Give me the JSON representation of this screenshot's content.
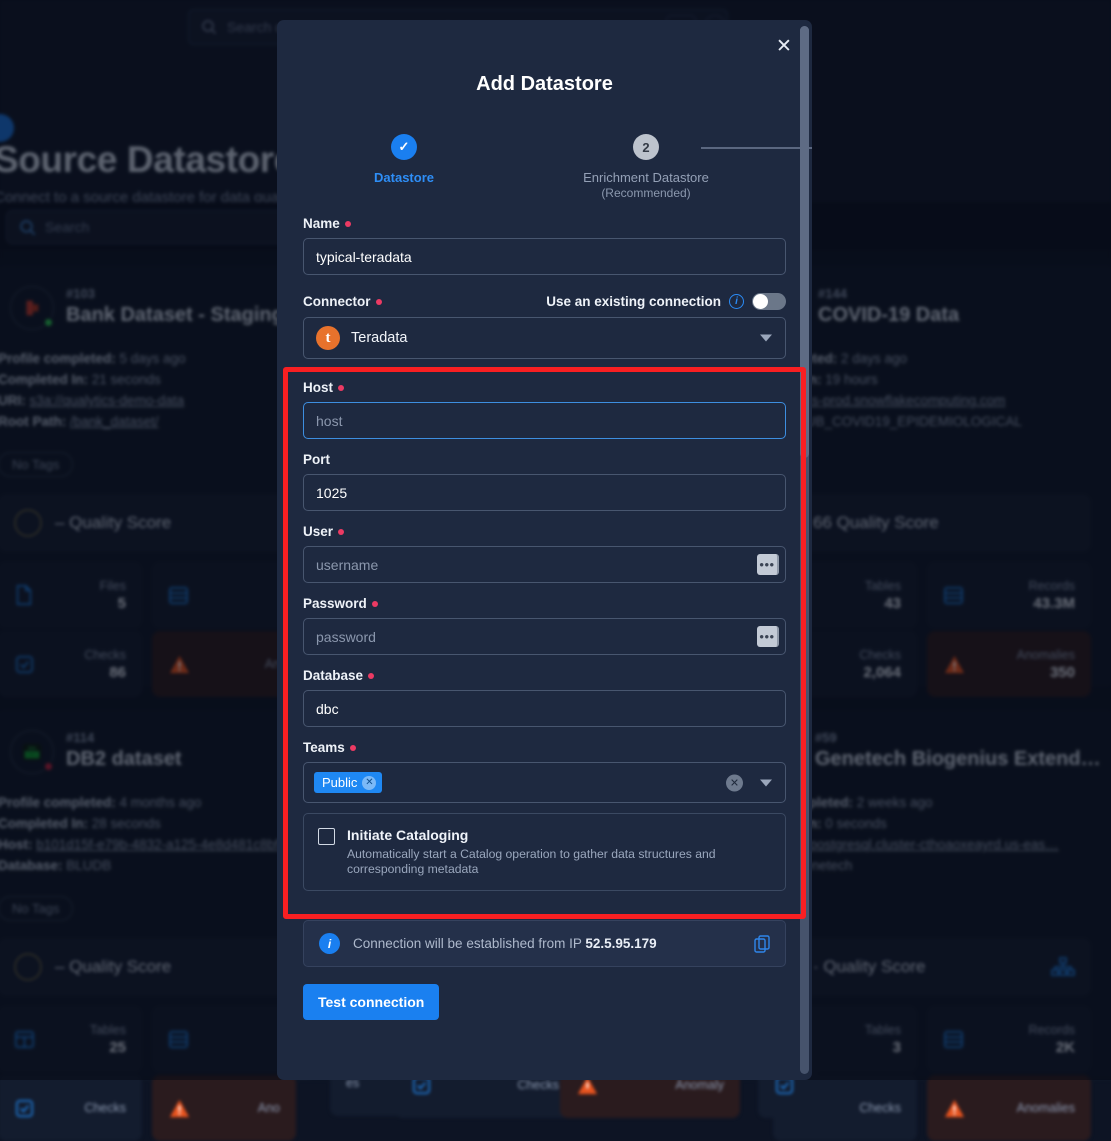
{
  "background": {
    "topbar": {
      "search_placeholder": "Search datastores, containers and fields"
    },
    "hero": {
      "title": "Source Datastores",
      "subtitle": "Connect to a source datastore for data quality a"
    },
    "list_search_placeholder": "Search",
    "cards": [
      {
        "id": "#103",
        "title": "Bank Dataset - Staging",
        "status_color": "#2ac44f",
        "icon_color": "#c0392b",
        "meta": [
          {
            "label": "Profile completed:",
            "value": " 5 days ago"
          },
          {
            "label": "Completed In:",
            "value": " 21 seconds"
          },
          {
            "label": "URI:",
            "value": " s3a://qualytics-demo-data",
            "link": true
          },
          {
            "label": "Root Path:",
            "value": " /bank_dataset/",
            "link": true
          }
        ],
        "tag": "No Tags",
        "quality_score": "–  Quality Score",
        "stats": [
          {
            "label": "Files",
            "value": "5",
            "icon": "file-icon"
          },
          {
            "label": "",
            "value": "",
            "icon": "database-icon"
          },
          {
            "label": "Checks",
            "value": "86",
            "icon": "check-doc-icon"
          },
          {
            "label": "An",
            "value": "",
            "icon": "warning-icon",
            "warn": true
          }
        ]
      },
      {
        "id": "#144",
        "title": "COVID-19 Data",
        "meta": [
          {
            "label": "mpleted:",
            "value": " 2 days ago"
          },
          {
            "label": "ted In:",
            "value": " 19 hours"
          },
          {
            "label": "",
            "value": "alytics-prod.snowflakecomputing.com",
            "link": true
          },
          {
            "label": "e:",
            "value": " PUB_COVID19_EPIDEMIOLOGICAL"
          }
        ],
        "quality_score": "66  Quality Score",
        "stats": [
          {
            "label": "Tables",
            "value": "43",
            "icon": ""
          },
          {
            "label": "Records",
            "value": "43.3M",
            "icon": "database-icon"
          },
          {
            "label": "Checks",
            "value": "2,064",
            "icon": ""
          },
          {
            "label": "Anomalies",
            "value": "350",
            "icon": "warning-icon",
            "warn": true
          }
        ]
      },
      {
        "id": "#114",
        "title": "DB2 dataset",
        "status_color": "#c0223e",
        "meta": [
          {
            "label": "Profile completed:",
            "value": " 4 months ago"
          },
          {
            "label": "Completed In:",
            "value": " 28 seconds"
          },
          {
            "label": "Host:",
            "value": " b101d15f-e79b-4832-a125-4e8d481c8bf",
            "link": true
          },
          {
            "label": "Database:",
            "value": " BLUDB"
          }
        ],
        "tag": "No Tags",
        "quality_score": "–  Quality Score",
        "stats": [
          {
            "label": "Tables",
            "value": "25",
            "icon": "grid-icon"
          },
          {
            "label": "",
            "value": "",
            "icon": "database-icon"
          },
          {
            "label": "Checks",
            "value": "",
            "icon": "check-doc-icon"
          },
          {
            "label": "Ano",
            "value": "",
            "icon": "warning-icon",
            "warn": true
          }
        ]
      },
      {
        "id": "#59",
        "title": "Genetech Biogenius Extend…",
        "meta": [
          {
            "label": "completed:",
            "value": " 2 weeks ago"
          },
          {
            "label": "ted In:",
            "value": " 0 seconds"
          },
          {
            "label": "",
            "value": "rora-postgresql.cluster-cthoaoxeayrd.us-eas…",
            "link": true
          },
          {
            "label": "e:",
            "value": " genetech"
          }
        ],
        "quality_score": "·  Quality Score",
        "stats": [
          {
            "label": "Tables",
            "value": "3",
            "icon": ""
          },
          {
            "label": "Records",
            "value": "2K",
            "icon": "database-icon"
          },
          {
            "label": "Checks",
            "value": "",
            "icon": ""
          },
          {
            "label": "Anomalies",
            "value": "",
            "icon": "warning-icon",
            "warn": true
          }
        ]
      }
    ],
    "bottom_labels": {
      "checks": "Checks",
      "anomaly": "Anomaly",
      "es": "es"
    }
  },
  "modal": {
    "title": "Add Datastore",
    "close_label": "✕",
    "stepper": {
      "step1": {
        "marker": "✓",
        "label": "Datastore"
      },
      "step2": {
        "marker": "2",
        "label": "Enrichment Datastore",
        "sublabel": "(Recommended)"
      }
    },
    "fields": {
      "name": {
        "label": "Name",
        "value": "typical-teradata",
        "required": true
      },
      "connector": {
        "label": "Connector",
        "required": true,
        "toggle_label": "Use an existing connection",
        "toggle_on": false,
        "selected": "Teradata",
        "icon_letter": "t"
      },
      "host": {
        "label": "Host",
        "placeholder": "host",
        "value": "",
        "required": true,
        "focused": true
      },
      "port": {
        "label": "Port",
        "placeholder": "",
        "value": "1025",
        "required": false
      },
      "user": {
        "label": "User",
        "placeholder": "username",
        "value": "",
        "required": true,
        "has_dots": true
      },
      "password": {
        "label": "Password",
        "placeholder": "password",
        "value": "",
        "required": true,
        "has_dots": true
      },
      "database": {
        "label": "Database",
        "placeholder": "",
        "value": "dbc",
        "required": true
      },
      "teams": {
        "label": "Teams",
        "required": true,
        "chips": [
          "Public"
        ]
      },
      "catalog": {
        "title": "Initiate Cataloging",
        "description": "Automatically start a Catalog operation to gather data structures and corresponding metadata",
        "checked": false
      }
    },
    "info_bar": {
      "text_prefix": "Connection will be established from IP ",
      "ip": "52.5.95.179"
    },
    "test_button": "Test connection"
  },
  "colors": {
    "accent_blue": "#1a80f0",
    "highlight_red": "#f81f22",
    "required_pink": "#ec3a63",
    "connector_orange": "#e8722c",
    "modal_bg": "#1e2940"
  }
}
